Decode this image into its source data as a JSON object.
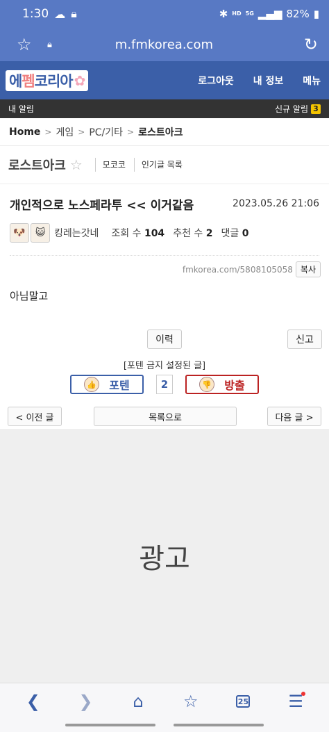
{
  "status_bar": {
    "time": "1:30",
    "battery": "82%",
    "hd_label": "HD",
    "g5_label": "5G"
  },
  "browser": {
    "url": "m.fmkorea.com"
  },
  "site_header": {
    "logo_part1": "에",
    "logo_part2": "펨",
    "logo_part3": "코리아",
    "nav": [
      "로그아웃",
      "내 정보",
      "메뉴"
    ]
  },
  "alert_bar": {
    "left": "내 알림",
    "right": "신규 알림",
    "count": "3"
  },
  "breadcrumb": {
    "home": "Home",
    "items": [
      "게임",
      "PC/기타"
    ],
    "current": "로스트아크"
  },
  "board": {
    "title": "로스트아크",
    "links": [
      "모코코",
      "인기글 목록"
    ]
  },
  "post": {
    "title": "개인적으로 노스페라투 << 이거같음",
    "date": "2023.05.26 21:06",
    "author": "킹레는갓네",
    "views_label": "조회 수",
    "views": "104",
    "recommend_label": "추천 수",
    "recommend": "2",
    "comments_label": "댓글",
    "comments": "0",
    "short_url": "fmkorea.com/5808105058",
    "copy_label": "복사",
    "content": "아님말고",
    "history_label": "이력",
    "report_label": "신고"
  },
  "vote": {
    "note": "[포텐 금지 설정된 글]",
    "up_label": "포텐",
    "count": "2",
    "down_label": "방출"
  },
  "post_nav": {
    "prev": "< 이전 글",
    "list": "목록으로",
    "next": "다음 글 >"
  },
  "ad": {
    "label": "광고"
  },
  "bottom_bar": {
    "tab_count": "25"
  },
  "colors": {
    "browser_bar": "#5879c4",
    "site_header": "#3b5fa8",
    "alert_badge": "#f4c400",
    "vote_up": "#3b5fa8",
    "vote_down": "#bb2222"
  }
}
